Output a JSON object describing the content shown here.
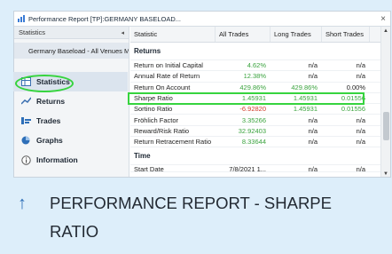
{
  "window": {
    "title": "Performance Report [TP]:GERMANY BASELOAD...",
    "close_label": "×"
  },
  "sidebar": {
    "header": "Statistics",
    "collapse_label": "◂",
    "venue": "Germany Baseload - All Venues M...",
    "items": [
      {
        "label": "Statistics",
        "icon": "statistics-icon"
      },
      {
        "label": "Returns",
        "icon": "returns-icon"
      },
      {
        "label": "Trades",
        "icon": "trades-icon"
      },
      {
        "label": "Graphs",
        "icon": "graphs-icon"
      },
      {
        "label": "Information",
        "icon": "information-icon"
      }
    ]
  },
  "grid": {
    "columns": [
      "Statistic",
      "All Trades",
      "Long Trades",
      "Short Trades"
    ],
    "sections": [
      {
        "title": "Returns",
        "rows": [
          {
            "stat": "Return on Initial Capital",
            "all": "4.62%",
            "long": "n/a",
            "short": "n/a"
          },
          {
            "stat": "Annual Rate of Return",
            "all": "12.38%",
            "long": "n/a",
            "short": "n/a"
          },
          {
            "stat": "Return On Account",
            "all": "429.86%",
            "long": "429.86%",
            "short": "0.00%"
          },
          {
            "stat": "Sharpe Ratio",
            "all": "1.45931",
            "long": "1.45931",
            "short": "0.01556"
          },
          {
            "stat": "Sortino Ratio",
            "all": "-6.92820",
            "long": "1.45931",
            "short": "0.01556"
          },
          {
            "stat": "Fröhlich Factor",
            "all": "3.35266",
            "long": "n/a",
            "short": "n/a"
          },
          {
            "stat": "Reward/Risk Ratio",
            "all": "32.92403",
            "long": "n/a",
            "short": "n/a"
          },
          {
            "stat": "Return Retracement Ratio",
            "all": "8.33644",
            "long": "n/a",
            "short": "n/a"
          }
        ]
      },
      {
        "title": "Time",
        "rows": [
          {
            "stat": "Start Date",
            "all": "7/8/2021 1...",
            "long": "n/a",
            "short": "n/a"
          }
        ]
      }
    ]
  },
  "scrollbar": {
    "up": "▲",
    "down": "▼"
  },
  "caption": {
    "arrow": "↑",
    "text": "PERFORMANCE REPORT - SHARPE RATIO"
  },
  "colors": {
    "highlight": "#36d43e",
    "positive": "#3aa33e",
    "negative": "#d23c2c",
    "background": "#ddeefa"
  }
}
